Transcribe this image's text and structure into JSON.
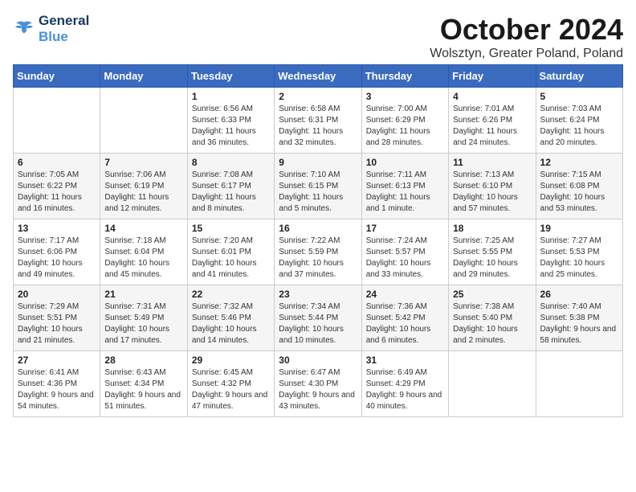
{
  "logo": {
    "line1": "General",
    "line2": "Blue"
  },
  "title": "October 2024",
  "subtitle": "Wolsztyn, Greater Poland, Poland",
  "days_of_week": [
    "Sunday",
    "Monday",
    "Tuesday",
    "Wednesday",
    "Thursday",
    "Friday",
    "Saturday"
  ],
  "weeks": [
    [
      {
        "day": "",
        "sunrise": "",
        "sunset": "",
        "daylight": ""
      },
      {
        "day": "",
        "sunrise": "",
        "sunset": "",
        "daylight": ""
      },
      {
        "day": "1",
        "sunrise": "Sunrise: 6:56 AM",
        "sunset": "Sunset: 6:33 PM",
        "daylight": "Daylight: 11 hours and 36 minutes."
      },
      {
        "day": "2",
        "sunrise": "Sunrise: 6:58 AM",
        "sunset": "Sunset: 6:31 PM",
        "daylight": "Daylight: 11 hours and 32 minutes."
      },
      {
        "day": "3",
        "sunrise": "Sunrise: 7:00 AM",
        "sunset": "Sunset: 6:29 PM",
        "daylight": "Daylight: 11 hours and 28 minutes."
      },
      {
        "day": "4",
        "sunrise": "Sunrise: 7:01 AM",
        "sunset": "Sunset: 6:26 PM",
        "daylight": "Daylight: 11 hours and 24 minutes."
      },
      {
        "day": "5",
        "sunrise": "Sunrise: 7:03 AM",
        "sunset": "Sunset: 6:24 PM",
        "daylight": "Daylight: 11 hours and 20 minutes."
      }
    ],
    [
      {
        "day": "6",
        "sunrise": "Sunrise: 7:05 AM",
        "sunset": "Sunset: 6:22 PM",
        "daylight": "Daylight: 11 hours and 16 minutes."
      },
      {
        "day": "7",
        "sunrise": "Sunrise: 7:06 AM",
        "sunset": "Sunset: 6:19 PM",
        "daylight": "Daylight: 11 hours and 12 minutes."
      },
      {
        "day": "8",
        "sunrise": "Sunrise: 7:08 AM",
        "sunset": "Sunset: 6:17 PM",
        "daylight": "Daylight: 11 hours and 8 minutes."
      },
      {
        "day": "9",
        "sunrise": "Sunrise: 7:10 AM",
        "sunset": "Sunset: 6:15 PM",
        "daylight": "Daylight: 11 hours and 5 minutes."
      },
      {
        "day": "10",
        "sunrise": "Sunrise: 7:11 AM",
        "sunset": "Sunset: 6:13 PM",
        "daylight": "Daylight: 11 hours and 1 minute."
      },
      {
        "day": "11",
        "sunrise": "Sunrise: 7:13 AM",
        "sunset": "Sunset: 6:10 PM",
        "daylight": "Daylight: 10 hours and 57 minutes."
      },
      {
        "day": "12",
        "sunrise": "Sunrise: 7:15 AM",
        "sunset": "Sunset: 6:08 PM",
        "daylight": "Daylight: 10 hours and 53 minutes."
      }
    ],
    [
      {
        "day": "13",
        "sunrise": "Sunrise: 7:17 AM",
        "sunset": "Sunset: 6:06 PM",
        "daylight": "Daylight: 10 hours and 49 minutes."
      },
      {
        "day": "14",
        "sunrise": "Sunrise: 7:18 AM",
        "sunset": "Sunset: 6:04 PM",
        "daylight": "Daylight: 10 hours and 45 minutes."
      },
      {
        "day": "15",
        "sunrise": "Sunrise: 7:20 AM",
        "sunset": "Sunset: 6:01 PM",
        "daylight": "Daylight: 10 hours and 41 minutes."
      },
      {
        "day": "16",
        "sunrise": "Sunrise: 7:22 AM",
        "sunset": "Sunset: 5:59 PM",
        "daylight": "Daylight: 10 hours and 37 minutes."
      },
      {
        "day": "17",
        "sunrise": "Sunrise: 7:24 AM",
        "sunset": "Sunset: 5:57 PM",
        "daylight": "Daylight: 10 hours and 33 minutes."
      },
      {
        "day": "18",
        "sunrise": "Sunrise: 7:25 AM",
        "sunset": "Sunset: 5:55 PM",
        "daylight": "Daylight: 10 hours and 29 minutes."
      },
      {
        "day": "19",
        "sunrise": "Sunrise: 7:27 AM",
        "sunset": "Sunset: 5:53 PM",
        "daylight": "Daylight: 10 hours and 25 minutes."
      }
    ],
    [
      {
        "day": "20",
        "sunrise": "Sunrise: 7:29 AM",
        "sunset": "Sunset: 5:51 PM",
        "daylight": "Daylight: 10 hours and 21 minutes."
      },
      {
        "day": "21",
        "sunrise": "Sunrise: 7:31 AM",
        "sunset": "Sunset: 5:49 PM",
        "daylight": "Daylight: 10 hours and 17 minutes."
      },
      {
        "day": "22",
        "sunrise": "Sunrise: 7:32 AM",
        "sunset": "Sunset: 5:46 PM",
        "daylight": "Daylight: 10 hours and 14 minutes."
      },
      {
        "day": "23",
        "sunrise": "Sunrise: 7:34 AM",
        "sunset": "Sunset: 5:44 PM",
        "daylight": "Daylight: 10 hours and 10 minutes."
      },
      {
        "day": "24",
        "sunrise": "Sunrise: 7:36 AM",
        "sunset": "Sunset: 5:42 PM",
        "daylight": "Daylight: 10 hours and 6 minutes."
      },
      {
        "day": "25",
        "sunrise": "Sunrise: 7:38 AM",
        "sunset": "Sunset: 5:40 PM",
        "daylight": "Daylight: 10 hours and 2 minutes."
      },
      {
        "day": "26",
        "sunrise": "Sunrise: 7:40 AM",
        "sunset": "Sunset: 5:38 PM",
        "daylight": "Daylight: 9 hours and 58 minutes."
      }
    ],
    [
      {
        "day": "27",
        "sunrise": "Sunrise: 6:41 AM",
        "sunset": "Sunset: 4:36 PM",
        "daylight": "Daylight: 9 hours and 54 minutes."
      },
      {
        "day": "28",
        "sunrise": "Sunrise: 6:43 AM",
        "sunset": "Sunset: 4:34 PM",
        "daylight": "Daylight: 9 hours and 51 minutes."
      },
      {
        "day": "29",
        "sunrise": "Sunrise: 6:45 AM",
        "sunset": "Sunset: 4:32 PM",
        "daylight": "Daylight: 9 hours and 47 minutes."
      },
      {
        "day": "30",
        "sunrise": "Sunrise: 6:47 AM",
        "sunset": "Sunset: 4:30 PM",
        "daylight": "Daylight: 9 hours and 43 minutes."
      },
      {
        "day": "31",
        "sunrise": "Sunrise: 6:49 AM",
        "sunset": "Sunset: 4:29 PM",
        "daylight": "Daylight: 9 hours and 40 minutes."
      },
      {
        "day": "",
        "sunrise": "",
        "sunset": "",
        "daylight": ""
      },
      {
        "day": "",
        "sunrise": "",
        "sunset": "",
        "daylight": ""
      }
    ]
  ]
}
